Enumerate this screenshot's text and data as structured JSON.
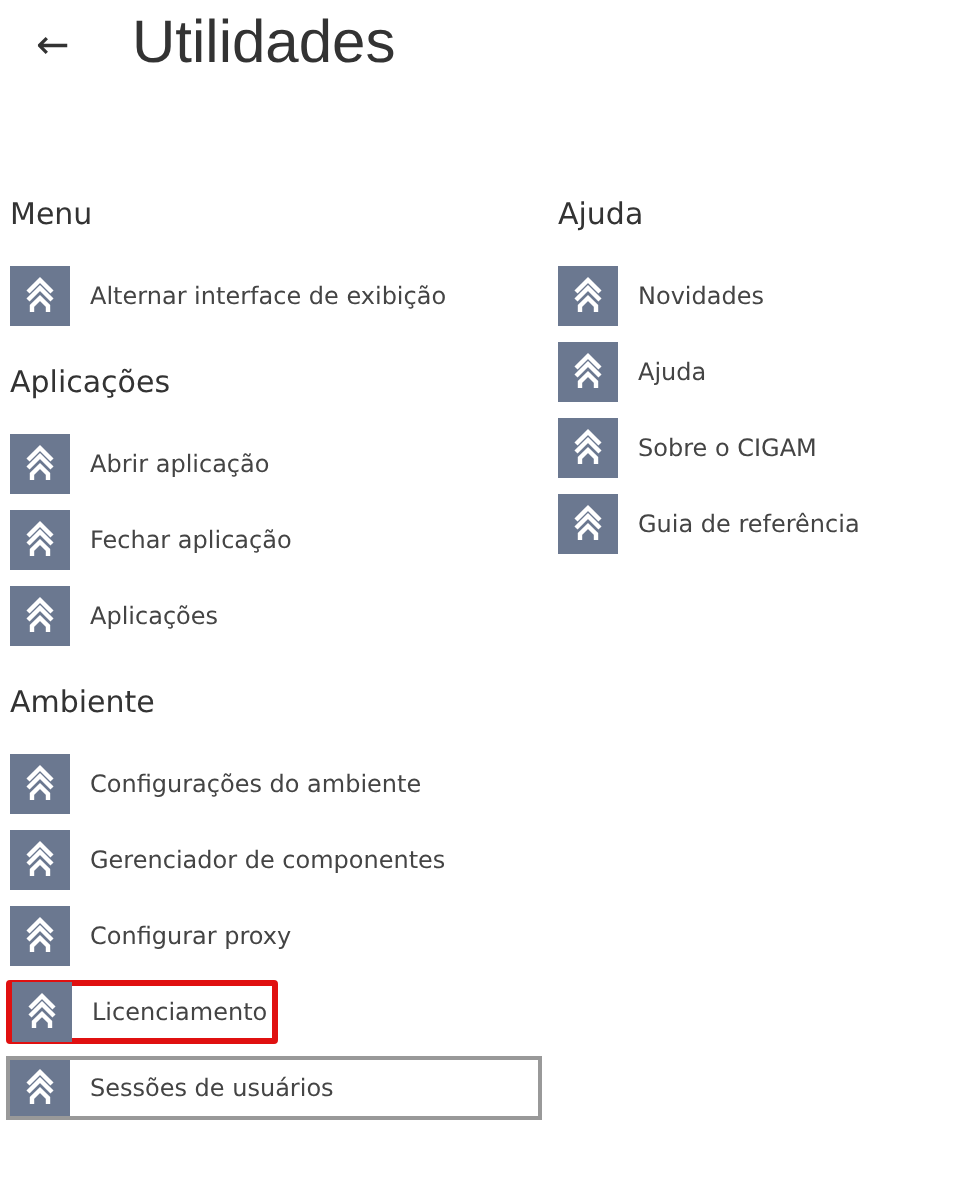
{
  "header": {
    "back_icon": "←",
    "title": "Utilidades"
  },
  "columns": [
    {
      "groups": [
        {
          "heading": "Menu",
          "items": [
            {
              "label": "Alternar interface de exibição",
              "selected": false,
              "highlighted": false
            }
          ]
        },
        {
          "heading": "Aplicações",
          "items": [
            {
              "label": "Abrir aplicação",
              "selected": false,
              "highlighted": false
            },
            {
              "label": "Fechar aplicação",
              "selected": false,
              "highlighted": false
            },
            {
              "label": "Aplicações",
              "selected": false,
              "highlighted": false
            }
          ]
        },
        {
          "heading": "Ambiente",
          "items": [
            {
              "label": "Configurações do ambiente",
              "selected": false,
              "highlighted": false
            },
            {
              "label": "Gerenciador de componentes",
              "selected": false,
              "highlighted": false
            },
            {
              "label": "Configurar proxy",
              "selected": false,
              "highlighted": false
            },
            {
              "label": "Licenciamento",
              "selected": false,
              "highlighted": true
            },
            {
              "label": "Sessões de usuários",
              "selected": true,
              "highlighted": false
            }
          ]
        }
      ]
    },
    {
      "groups": [
        {
          "heading": "Ajuda",
          "items": [
            {
              "label": "Novidades",
              "selected": false,
              "highlighted": false
            },
            {
              "label": "Ajuda",
              "selected": false,
              "highlighted": false
            },
            {
              "label": "Sobre o CIGAM",
              "selected": false,
              "highlighted": false
            },
            {
              "label": "Guia de referência",
              "selected": false,
              "highlighted": false
            }
          ]
        }
      ]
    }
  ]
}
